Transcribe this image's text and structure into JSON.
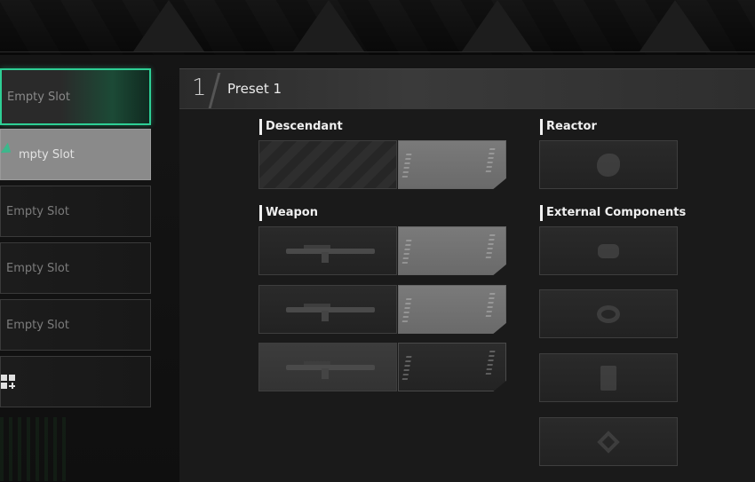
{
  "slots": [
    {
      "label": "Empty Slot",
      "state": "selected"
    },
    {
      "label": "Empty Slot",
      "state": "hover"
    },
    {
      "label": "Empty Slot",
      "state": "normal"
    },
    {
      "label": "Empty Slot",
      "state": "normal"
    },
    {
      "label": "Empty Slot",
      "state": "normal"
    }
  ],
  "hover_slot_visible_text": "mpty Slot",
  "add_slot_icon": "grid-plus-icon",
  "preset": {
    "number": "1",
    "name": "Preset 1"
  },
  "sections": {
    "descendant": "Descendant",
    "weapon": "Weapon",
    "reactor": "Reactor",
    "external_components": "External Components"
  },
  "colors": {
    "accent": "#2ecf95",
    "panel_bg": "#1a1a1a"
  }
}
